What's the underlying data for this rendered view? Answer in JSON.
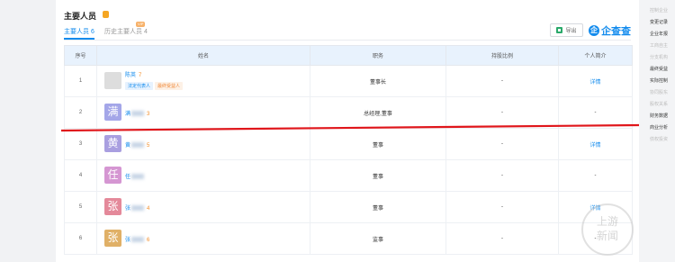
{
  "section": {
    "title": "主要人员"
  },
  "tabs": [
    {
      "label": "主要人员 6"
    },
    {
      "label": "历史主要人员 4"
    }
  ],
  "vip_badge": "VIP",
  "toolbar": {
    "export_label": "导出",
    "brand_logo": "企",
    "brand_name": "企查查"
  },
  "table": {
    "headers": [
      "序号",
      "姓名",
      "职务",
      "持股比例",
      "个人简介"
    ],
    "rows": [
      {
        "index": "1",
        "avatar": "",
        "name": "陈英",
        "count": "7",
        "tags": [
          "法定代表人",
          "最终受益人"
        ],
        "position": "董事长",
        "share": "-",
        "intro": "详情"
      },
      {
        "index": "2",
        "avatar": "满",
        "name": "满",
        "count": "3",
        "tags": [],
        "position": "总经理,董事",
        "share": "-",
        "intro": "-"
      },
      {
        "index": "3",
        "avatar": "黄",
        "name": "黄",
        "count": "5",
        "tags": [],
        "position": "董事",
        "share": "-",
        "intro": "详情"
      },
      {
        "index": "4",
        "avatar": "任",
        "name": "任",
        "count": "",
        "tags": [],
        "position": "董事",
        "share": "-",
        "intro": "-"
      },
      {
        "index": "5",
        "avatar": "张",
        "name": "张",
        "count": "4",
        "tags": [],
        "position": "董事",
        "share": "-",
        "intro": "详情"
      },
      {
        "index": "6",
        "avatar": "张",
        "name": "张",
        "count": "6",
        "tags": [],
        "position": "监事",
        "share": "-",
        "intro": "-"
      }
    ]
  },
  "avatar_colors": [
    "#ddd",
    "#a4a6e8",
    "#a99fe0",
    "#d596d2",
    "#e4899a",
    "#e0b067"
  ],
  "right_panel": {
    "items": [
      {
        "label": "控制企业",
        "dim": true
      },
      {
        "label": "变更记录",
        "dim": false
      },
      {
        "label": "企业年报",
        "dim": false
      },
      {
        "label": "工商自主",
        "dim": true
      },
      {
        "label": "分支机构",
        "dim": true
      },
      {
        "label": "最终受益",
        "dim": false
      },
      {
        "label": "实际控制",
        "dim": false
      },
      {
        "label": "协同股东",
        "dim": true
      },
      {
        "label": "股权关系",
        "dim": true
      },
      {
        "label": "财务数据",
        "dim": false
      },
      {
        "label": "商业分析",
        "dim": false
      },
      {
        "label": "债权投资",
        "dim": true
      }
    ]
  },
  "watermark": "上游新闻"
}
